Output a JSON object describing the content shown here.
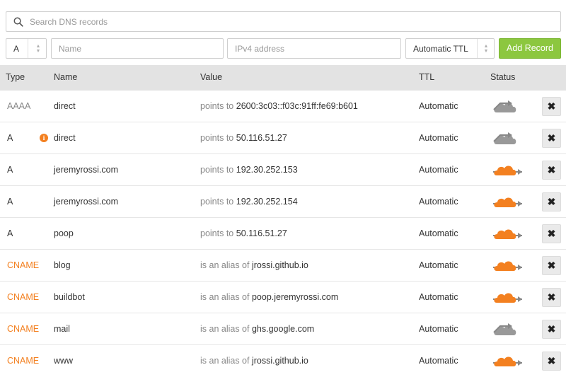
{
  "search": {
    "placeholder": "Search DNS records"
  },
  "add_record": {
    "type_value": "A",
    "name_placeholder": "Name",
    "value_placeholder": "IPv4 address",
    "ttl_value": "Automatic TTL",
    "add_label": "Add Record",
    "add_color": "#8cc73f"
  },
  "columns": {
    "type": "Type",
    "name": "Name",
    "value": "Value",
    "ttl": "TTL",
    "status": "Status"
  },
  "colors": {
    "cname": "#f38020",
    "aaaa": "#888888",
    "proxied_cloud": "#f38020",
    "dns_only_cloud": "#999999"
  },
  "records": [
    {
      "type": "AAAA",
      "name": "direct",
      "value_prefix": "points to",
      "value": "2600:3c03::f03c:91ff:fe69:b601",
      "ttl": "Automatic",
      "status": "dns-only",
      "info_badge": false
    },
    {
      "type": "A",
      "name": "direct",
      "value_prefix": "points to",
      "value": "50.116.51.27",
      "ttl": "Automatic",
      "status": "dns-only",
      "info_badge": true,
      "info_text": "i"
    },
    {
      "type": "A",
      "name": "jeremyrossi.com",
      "value_prefix": "points to",
      "value": "192.30.252.153",
      "ttl": "Automatic",
      "status": "proxied",
      "info_badge": false
    },
    {
      "type": "A",
      "name": "jeremyrossi.com",
      "value_prefix": "points to",
      "value": "192.30.252.154",
      "ttl": "Automatic",
      "status": "proxied",
      "info_badge": false
    },
    {
      "type": "A",
      "name": "poop",
      "value_prefix": "points to",
      "value": "50.116.51.27",
      "ttl": "Automatic",
      "status": "proxied",
      "info_badge": false
    },
    {
      "type": "CNAME",
      "name": "blog",
      "value_prefix": "is an alias of",
      "value": "jrossi.github.io",
      "ttl": "Automatic",
      "status": "proxied",
      "info_badge": false
    },
    {
      "type": "CNAME",
      "name": "buildbot",
      "value_prefix": "is an alias of",
      "value": "poop.jeremyrossi.com",
      "ttl": "Automatic",
      "status": "proxied",
      "info_badge": false
    },
    {
      "type": "CNAME",
      "name": "mail",
      "value_prefix": "is an alias of",
      "value": "ghs.google.com",
      "ttl": "Automatic",
      "status": "dns-only",
      "info_badge": false
    },
    {
      "type": "CNAME",
      "name": "www",
      "value_prefix": "is an alias of",
      "value": "jrossi.github.io",
      "ttl": "Automatic",
      "status": "proxied",
      "info_badge": false
    }
  ],
  "delete_glyph": "✖"
}
